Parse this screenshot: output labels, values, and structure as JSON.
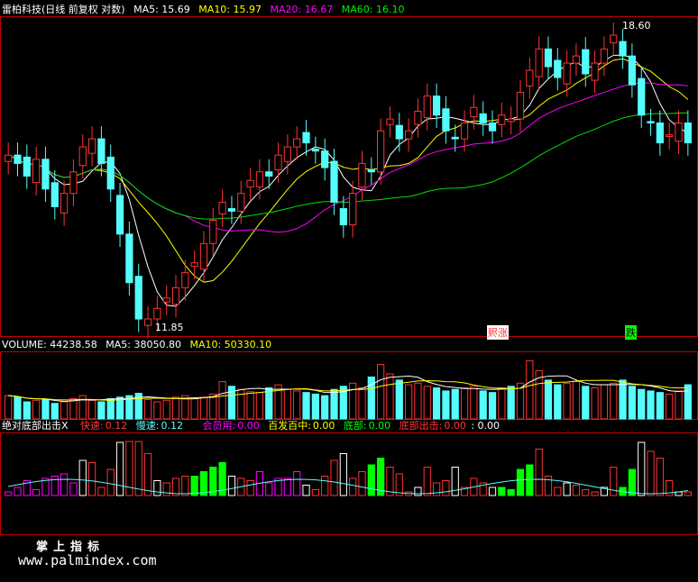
{
  "header": {
    "stock": "雷柏科技(日线 前复权 对数)",
    "ma5": "MA5: 15.69",
    "ma10": "MA10: 15.97",
    "ma20": "MA20: 16.67",
    "ma60": "MA60: 16.10"
  },
  "price_labels": {
    "high": "18.60",
    "low": "11.85",
    "buy_tag": "赆涨",
    "sell_tag": "跌"
  },
  "volume_header": {
    "volume": "VOLUME: 44238.58",
    "ma5": "MA5: 38050.80",
    "ma10": "MA10: 50330.10"
  },
  "indicator_header": {
    "name": "绝对底部出击X",
    "fast_label": "快速:",
    "fast_val": "0.12",
    "slow_label": "慢速:",
    "slow_val": "0.12",
    "member_label": "会员用:",
    "member_val": "0.00",
    "hit_label": "百发百中:",
    "hit_val": "0.00",
    "bottom_label": "底部:",
    "bottom_val": "0.00",
    "strike_label": "底部出击:",
    "strike_val": "0.00",
    "tail": ": 0.00"
  },
  "watermark": {
    "title": "掌上指标",
    "url": "www.palmindex.com"
  },
  "colors": {
    "up": "#ff3232",
    "down": "#54fcfc",
    "ma5": "#ffffff",
    "ma10": "#ffff00",
    "ma20": "#ff00ff",
    "ma60": "#00e000",
    "border": "#c00000"
  },
  "chart_data": {
    "type": "candlestick",
    "close": [
      15.4,
      15.2,
      14.9,
      15.3,
      14.6,
      14.2,
      14.5,
      15.0,
      15.6,
      15.8,
      15.2,
      14.6,
      13.6,
      12.6,
      11.9,
      11.9,
      12.1,
      12.3,
      12.5,
      12.8,
      13.0,
      13.4,
      13.9,
      14.3,
      14.1,
      14.5,
      14.8,
      15.0,
      14.9,
      15.4,
      15.6,
      15.8,
      15.7,
      15.5,
      15.1,
      14.3,
      13.8,
      14.5,
      15.2,
      15.0,
      16.0,
      16.3,
      15.8,
      16.0,
      16.5,
      16.9,
      16.4,
      16.0,
      15.8,
      16.2,
      16.6,
      16.2,
      16.0,
      16.4,
      16.3,
      17.0,
      17.6,
      18.2,
      17.7,
      17.4,
      17.8,
      18.0,
      17.5,
      17.8,
      18.2,
      18.6,
      18.0,
      17.2,
      16.4,
      16.2,
      15.7,
      15.9,
      16.2,
      15.7
    ],
    "volume": [
      30,
      28,
      22,
      24,
      25,
      20,
      22,
      26,
      30,
      24,
      22,
      26,
      28,
      30,
      33,
      25,
      22,
      24,
      28,
      30,
      26,
      28,
      32,
      48,
      42,
      38,
      35,
      34,
      40,
      44,
      38,
      36,
      34,
      32,
      30,
      38,
      42,
      46,
      40,
      54,
      70,
      58,
      50,
      44,
      46,
      42,
      40,
      36,
      38,
      40,
      42,
      36,
      34,
      40,
      42,
      46,
      75,
      62,
      50,
      44,
      46,
      48,
      42,
      40,
      44,
      46,
      50,
      42,
      38,
      36,
      34,
      32,
      36,
      44
    ],
    "ylim": [
      11.8,
      19.0
    ]
  }
}
